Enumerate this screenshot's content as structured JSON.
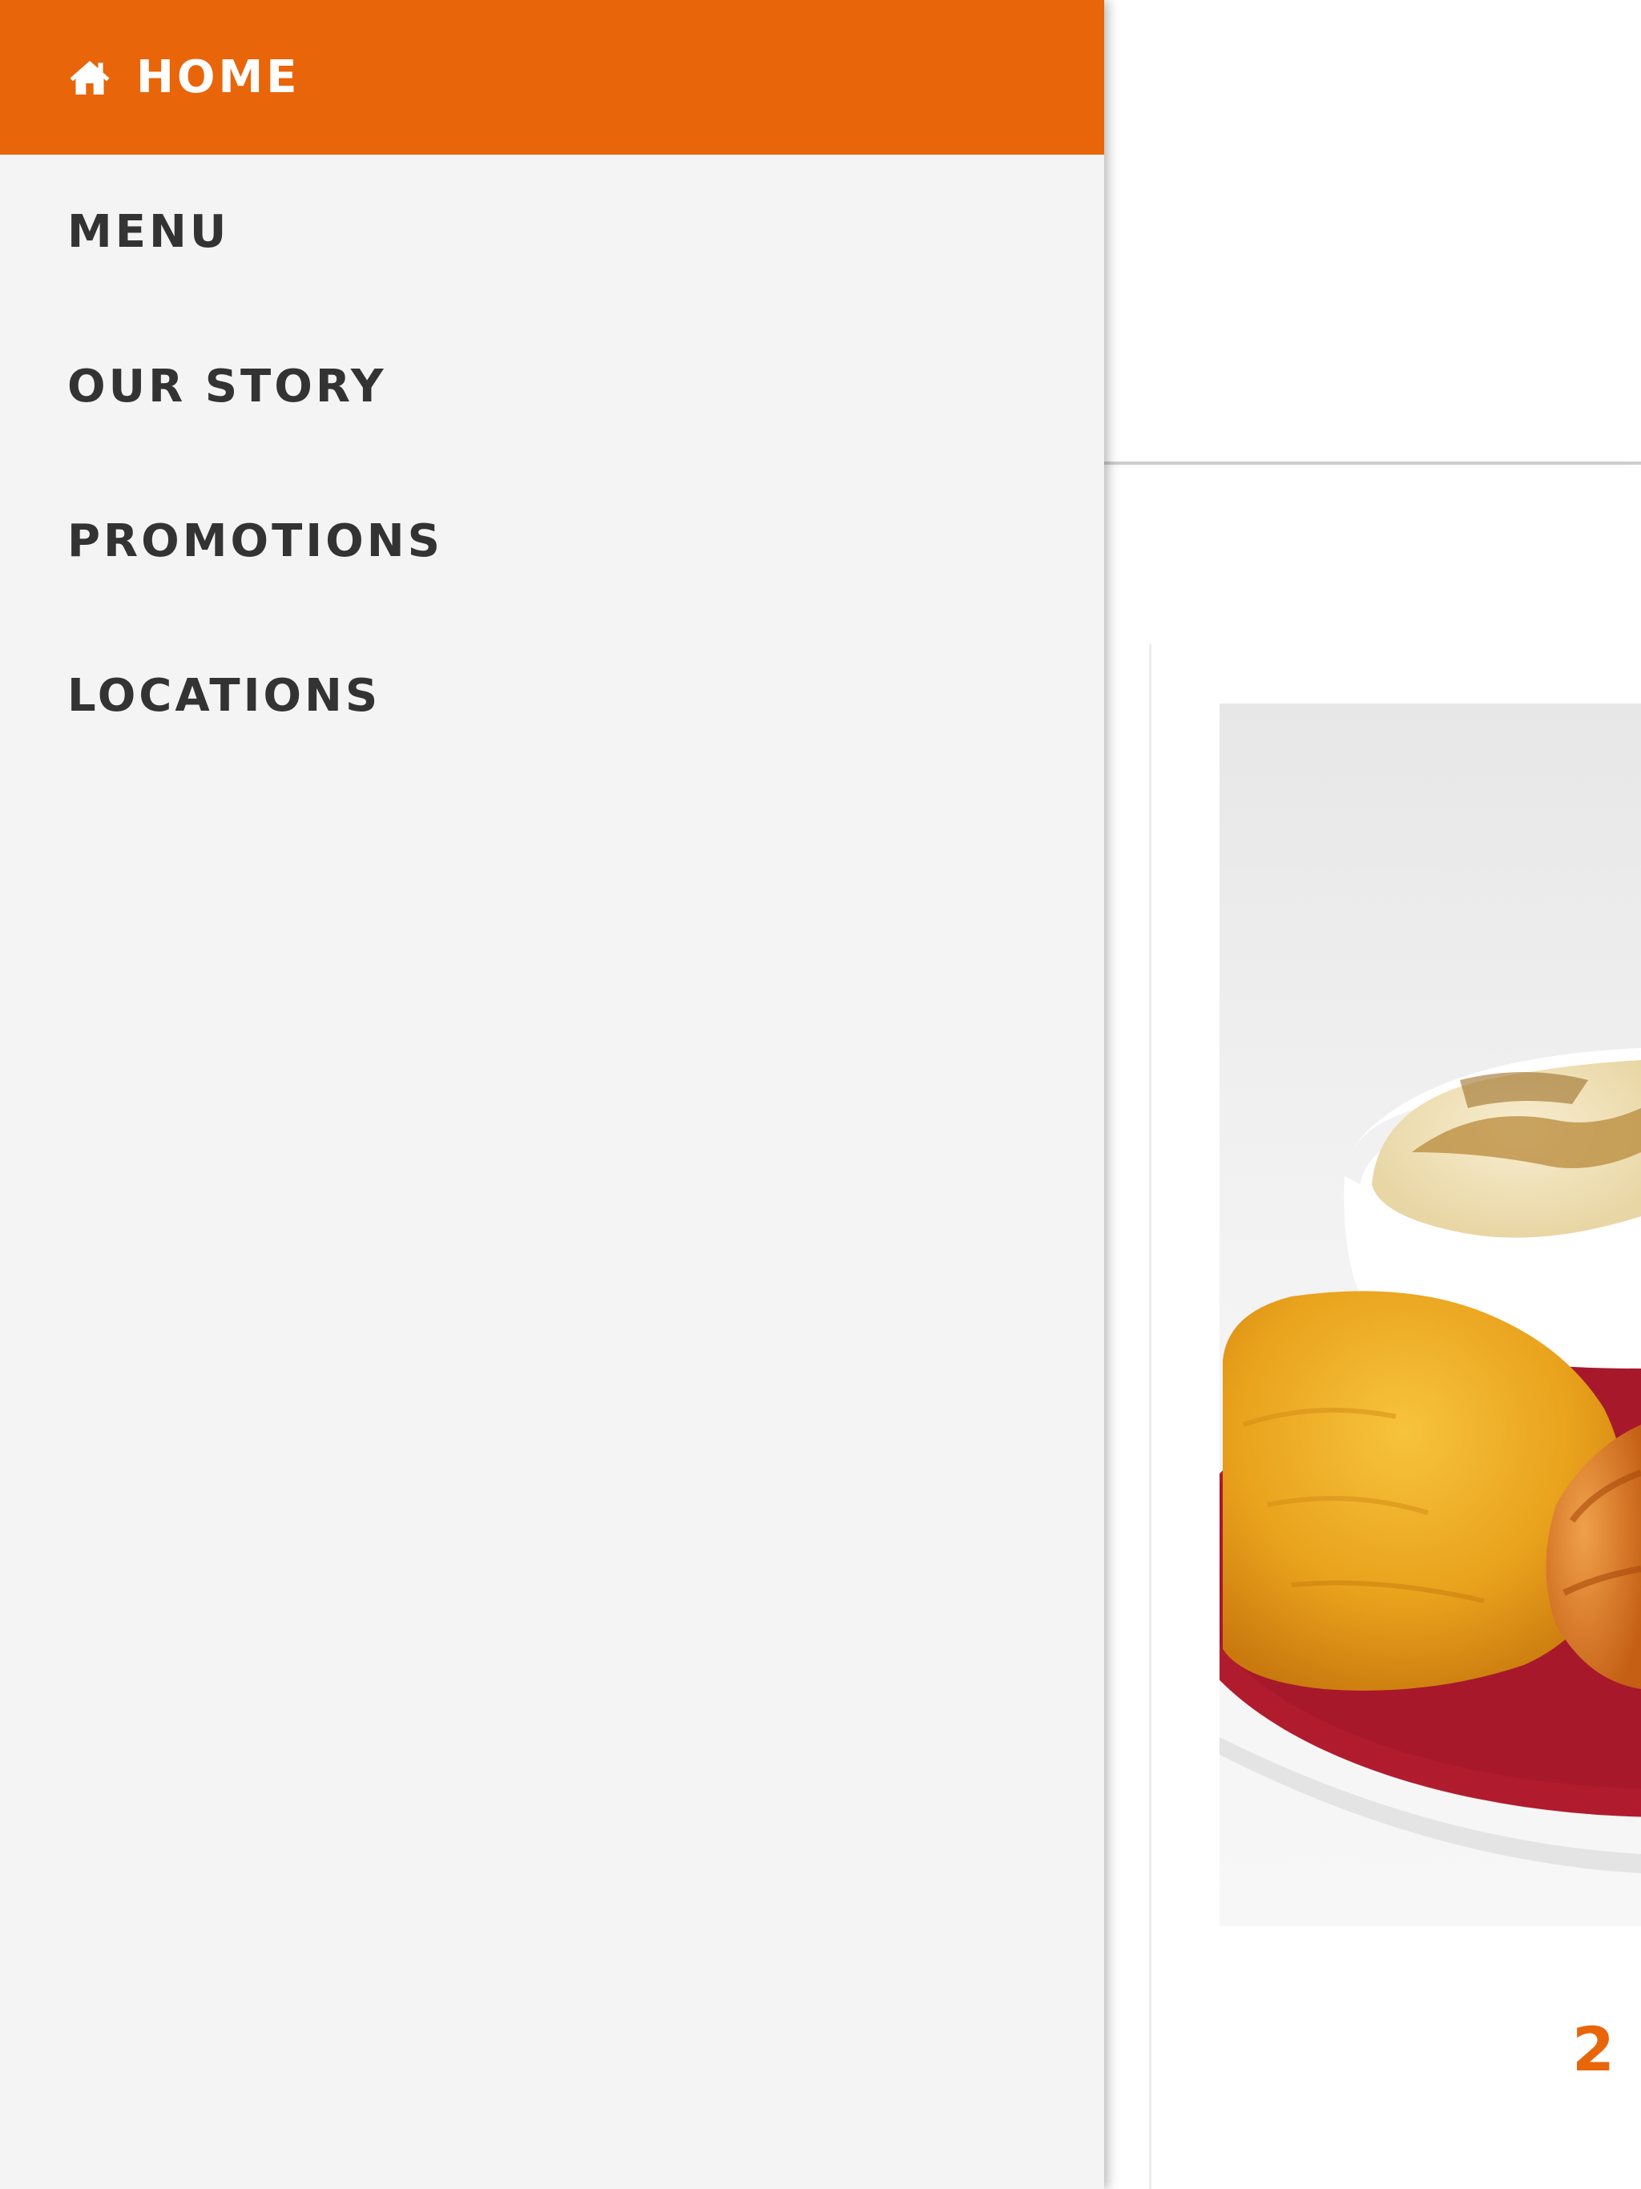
{
  "drawer": {
    "items": [
      {
        "label": "HOME",
        "icon": "home-icon",
        "active": true
      },
      {
        "label": "MENU"
      },
      {
        "label": "OUR STORY"
      },
      {
        "label": "PROMOTIONS"
      },
      {
        "label": "LOCATIONS"
      }
    ]
  },
  "content": {
    "card_number": "2",
    "photo": "food-photo"
  },
  "colors": {
    "accent": "#e8650a",
    "drawer_bg": "#f4f4f4",
    "nav_text": "#333333",
    "plate_red": "#a8182b"
  }
}
